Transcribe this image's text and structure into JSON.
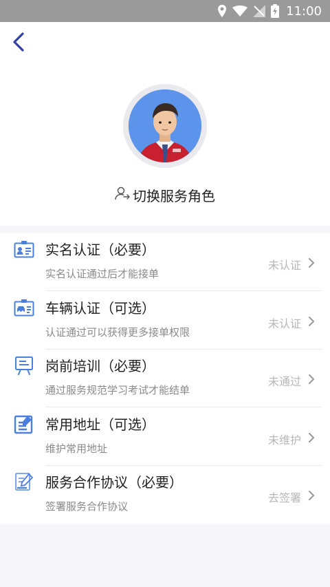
{
  "status_bar": {
    "time": "11:00"
  },
  "switch_role": {
    "label": "切换服务角色"
  },
  "items": [
    {
      "title": "实名认证（必要）",
      "desc": "实名认证通过后才能接单",
      "status": "未认证",
      "icon": "id-card-icon"
    },
    {
      "title": "车辆认证（可选）",
      "desc": "认证通过可以获得更多接单权限",
      "status": "未认证",
      "icon": "vehicle-card-icon"
    },
    {
      "title": "岗前培训（必要）",
      "desc": "通过服务规范学习考试才能结单",
      "status": "未通过",
      "icon": "training-board-icon"
    },
    {
      "title": "常用地址（可选）",
      "desc": "维护常用地址",
      "status": "未维护",
      "icon": "address-edit-icon"
    },
    {
      "title": "服务合作协议（必要）",
      "desc": "签署服务合作协议",
      "status": "去签署",
      "icon": "agreement-icon"
    }
  ],
  "colors": {
    "accent": "#4a7fe0",
    "status_gray": "#b7b7b7",
    "back_arrow": "#2f3ea8"
  }
}
